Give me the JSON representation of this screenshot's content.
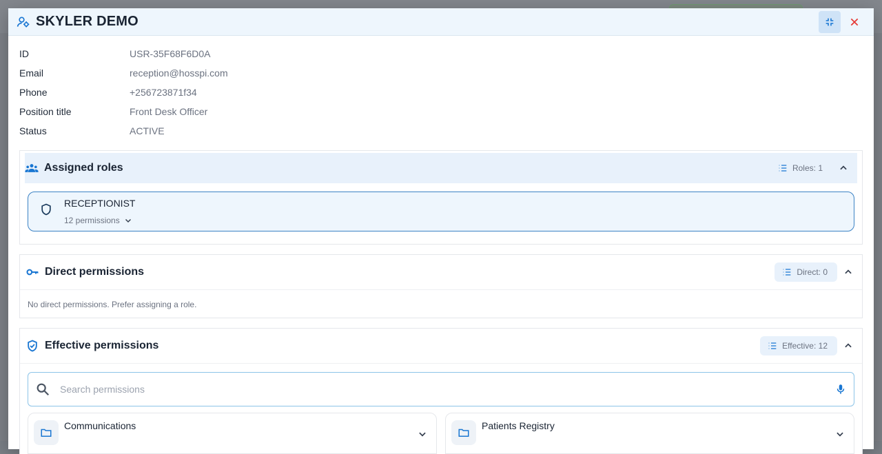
{
  "dialog": {
    "title": "SKYLER DEMO"
  },
  "details": [
    {
      "label": "ID",
      "value": "USR-35F68F6D0A"
    },
    {
      "label": "Email",
      "value": "reception@hosspi.com"
    },
    {
      "label": "Phone",
      "value": "+256723871f34"
    },
    {
      "label": "Position title",
      "value": "Front Desk Officer"
    },
    {
      "label": "Status",
      "value": "ACTIVE"
    }
  ],
  "assigned_roles": {
    "title": "Assigned roles",
    "count_label": "Roles: 1",
    "roles": [
      {
        "name": "RECEPTIONIST",
        "permissions_label": "12 permissions"
      }
    ]
  },
  "direct_permissions": {
    "title": "Direct permissions",
    "count_label": "Direct: 0",
    "empty_text": "No direct permissions. Prefer assigning a role."
  },
  "effective_permissions": {
    "title": "Effective permissions",
    "count_label": "Effective: 12",
    "search_placeholder": "Search permissions",
    "groups": [
      {
        "name": "Communications"
      },
      {
        "name": "Patients Registry"
      }
    ]
  },
  "colors": {
    "accent": "#1976d2",
    "close": "#e53935"
  }
}
